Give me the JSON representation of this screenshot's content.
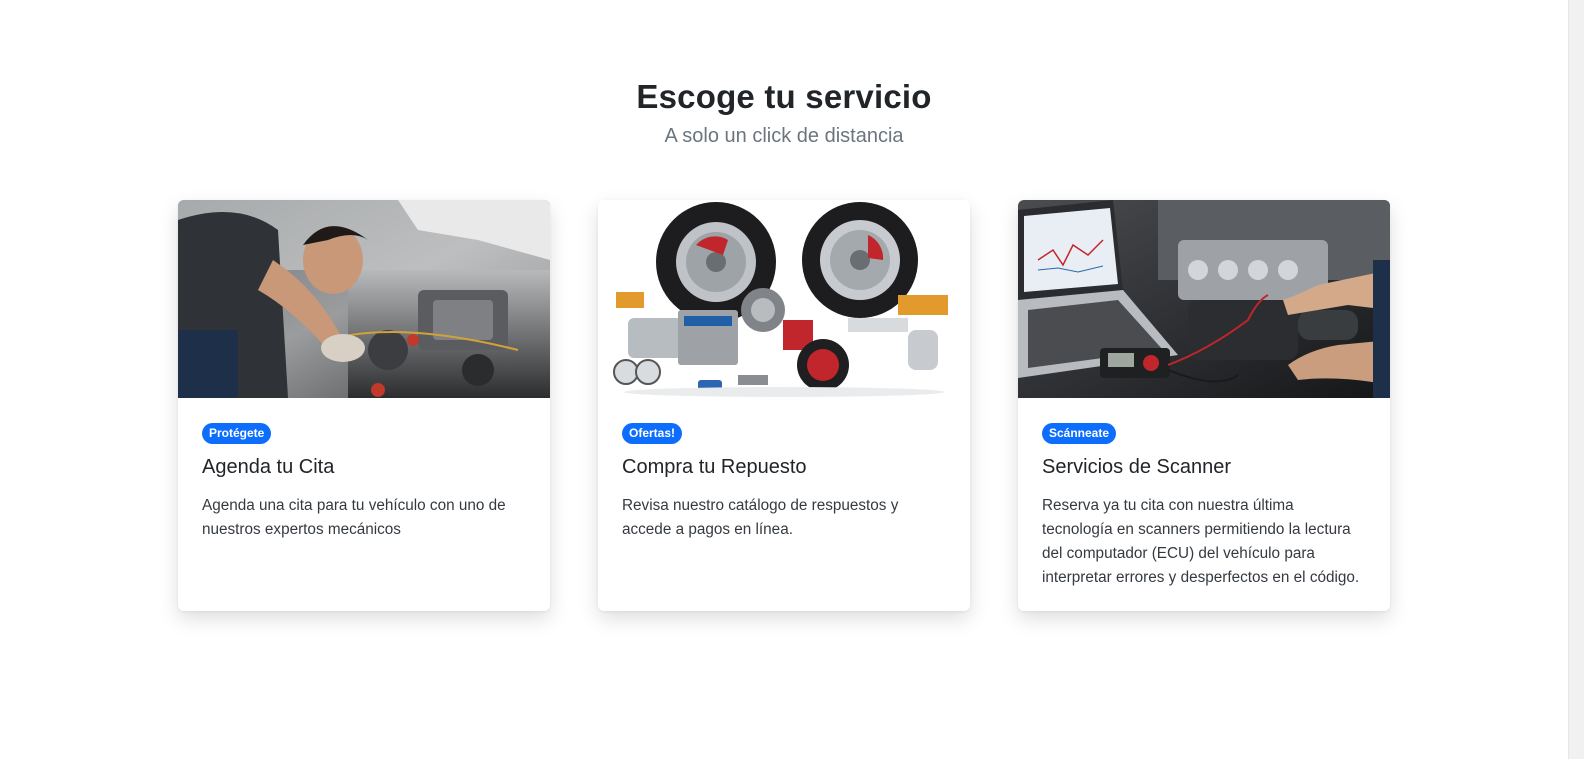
{
  "header": {
    "title": "Escoge tu servicio",
    "subtitle": "A solo un click de distancia"
  },
  "cards": [
    {
      "image": "mechanic-working-on-engine",
      "badge": "Protégete",
      "title": "Agenda tu Cita",
      "text": "Agenda una cita para tu vehículo con uno de nuestros expertos mecánicos"
    },
    {
      "image": "auto-parts-wheels-collection",
      "badge": "Ofertas!",
      "title": "Compra tu Repuesto",
      "text": "Revisa nuestro catálogo de respuestos y accede a pagos en línea."
    },
    {
      "image": "laptop-scanner-engine-diagnostics",
      "badge": "Scánneate",
      "title": "Servicios de Scanner",
      "text": "Reserva ya tu cita con nuestra última tecnología en scanners permitiendo la lectura del computador (ECU) del vehículo para interpretar errores y desperfectos en el código."
    }
  ],
  "colors": {
    "badge": "#0d6efd",
    "title": "#212529",
    "subtitle": "#6c757d",
    "background": "#ffffff"
  }
}
